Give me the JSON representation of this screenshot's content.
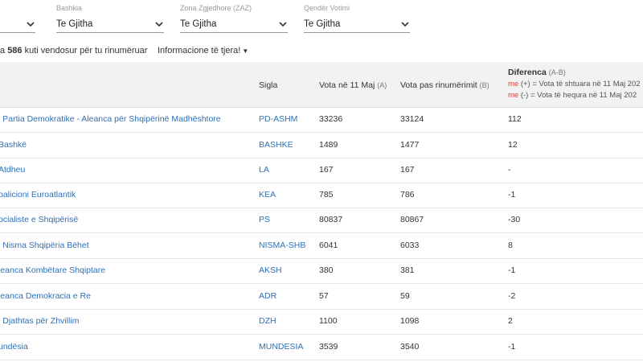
{
  "filters": [
    {
      "label": "",
      "value": ""
    },
    {
      "label": "Bashkia",
      "value": "Te Gjitha"
    },
    {
      "label": "Zona Zgjedhore (ZAZ)",
      "value": "Te Gjitha"
    },
    {
      "label": "Qendër Votimi",
      "value": "Te Gjitha"
    }
  ],
  "info": {
    "prefix": "a ",
    "count": "586",
    "suffix": " kuti vendosur për tu rinumëruar",
    "more": "Informacione të tjera!"
  },
  "table": {
    "headers": {
      "sigla": "Sigla",
      "vota1": "Vota në 11 Maj",
      "vota1_sub": "(A)",
      "vota2": "Vota pas rinumërimit",
      "vota2_sub": "(B)",
      "diff": "Diferenca",
      "diff_sub": "(A-B)",
      "legend_plus_me": "me",
      "legend_plus": " (+) = Vota të shtuara në 11 Maj 202",
      "legend_minus_me": "me",
      "legend_minus": " (-) = Vota të hequra në 11 Maj 202"
    },
    "rows": [
      {
        "party": "i Partia Demokratike - Aleanca për Shqipërinë Madhështore",
        "abbr": "PD-ASHM",
        "v1": "33236",
        "v2": "33124",
        "diff": "112"
      },
      {
        "party": "Bashkë",
        "abbr": "BASHKE",
        "v1": "1489",
        "v2": "1477",
        "diff": "12"
      },
      {
        "party": "Atdheu",
        "abbr": "LA",
        "v1": "167",
        "v2": "167",
        "diff": "-"
      },
      {
        "party": "oalicioni Euroatlantik",
        "abbr": "KEA",
        "v1": "785",
        "v2": "786",
        "diff": "-1"
      },
      {
        "party": "ocialiste e Shqipërisë",
        "abbr": "PS",
        "v1": "80837",
        "v2": "80867",
        "diff": "-30"
      },
      {
        "party": "i Nisma Shqipëria Bëhet",
        "abbr": "NISMA-SHB",
        "v1": "6041",
        "v2": "6033",
        "diff": "8"
      },
      {
        "party": "leanca Kombëtare Shqiptare",
        "abbr": "AKSH",
        "v1": "380",
        "v2": "381",
        "diff": "-1"
      },
      {
        "party": "leanca Demokracia e Re",
        "abbr": "ADR",
        "v1": "57",
        "v2": "59",
        "diff": "-2"
      },
      {
        "party": "i Djathtas për Zhvillim",
        "abbr": "DZH",
        "v1": "1100",
        "v2": "1098",
        "diff": "2"
      },
      {
        "party": "undësia",
        "abbr": "MUNDESIA",
        "v1": "3539",
        "v2": "3540",
        "diff": "-1"
      }
    ]
  },
  "colors": {
    "link": "#2f6fb5",
    "accent_red": "#e53935",
    "header_bg": "#f2f2f2"
  }
}
